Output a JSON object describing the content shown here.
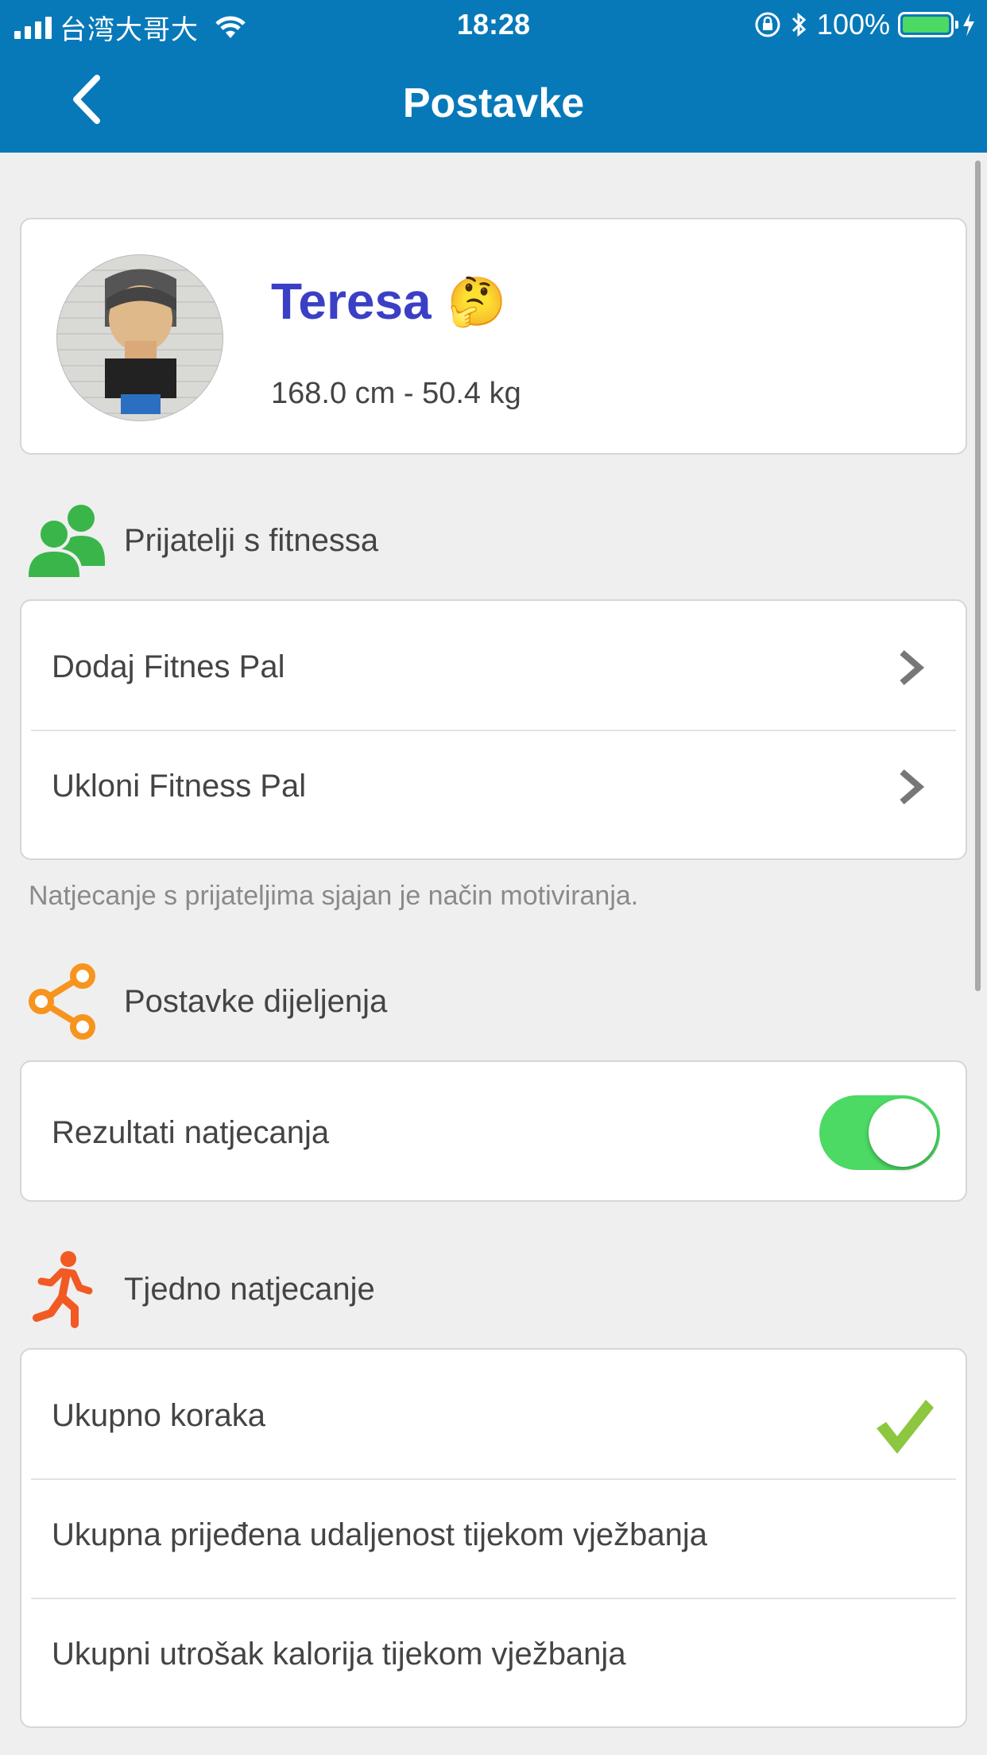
{
  "status_bar": {
    "carrier": "台湾大哥大",
    "time": "18:28",
    "battery": "100%"
  },
  "nav": {
    "title": "Postavke"
  },
  "profile": {
    "name": "Teresa",
    "emoji": "🤔",
    "stats": "168.0 cm - 50.4 kg"
  },
  "friends": {
    "header": "Prijatelji s fitnessa",
    "items": [
      {
        "label": "Dodaj Fitnes Pal"
      },
      {
        "label": "Ukloni Fitness Pal"
      }
    ],
    "footnote": "Natjecanje s prijateljima sjajan je način motiviranja."
  },
  "sharing": {
    "header": "Postavke dijeljenja",
    "items": [
      {
        "label": "Rezultati natjecanja",
        "toggle_on": true
      }
    ]
  },
  "weekly": {
    "header": "Tjedno natjecanje",
    "items": [
      {
        "label": "Ukupno koraka",
        "selected": true
      },
      {
        "label": "Ukupna prijeđena udaljenost tijekom vježbanja",
        "selected": false
      },
      {
        "label": "Ukupni utrošak kalorija tijekom vježbanja",
        "selected": false
      }
    ]
  },
  "colors": {
    "header_bg": "#0779b9",
    "name": "#3b3fc6",
    "friends_icon": "#3ab54a",
    "share_icon": "#f7941d",
    "run_icon": "#f15a22",
    "toggle_on": "#4cd964",
    "check": "#8dc63f"
  }
}
